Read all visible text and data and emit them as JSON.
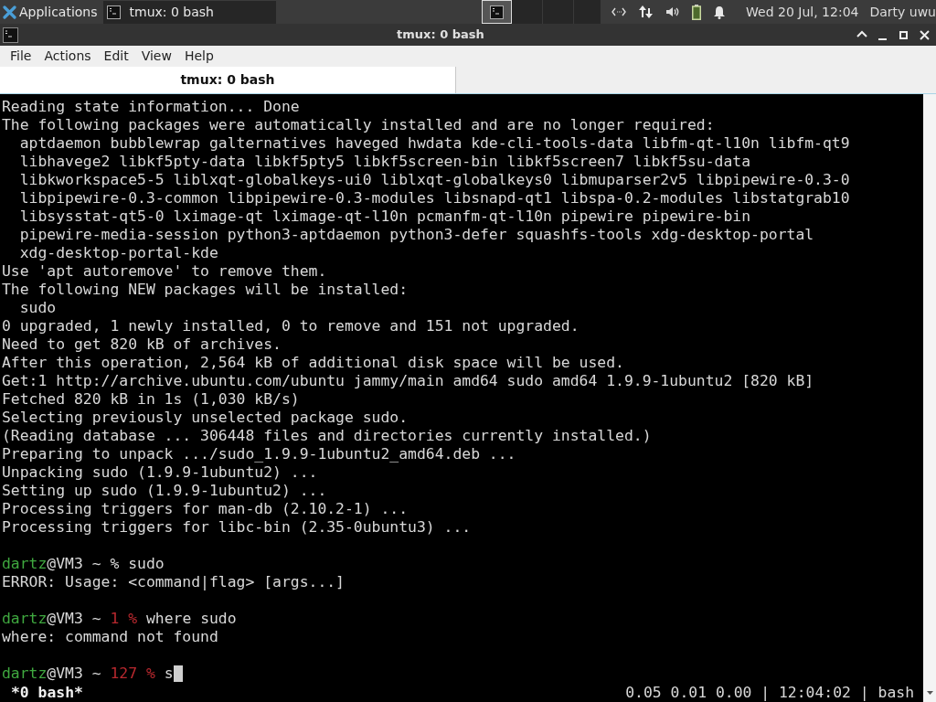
{
  "panel": {
    "apps_label": "Applications",
    "tasks": [
      {
        "label": "tmux: 0 bash",
        "selected": true
      }
    ],
    "clock": "Wed 20 Jul, 12:04",
    "user": "Darty uwu"
  },
  "window": {
    "title": "tmux: 0 bash"
  },
  "menu": [
    "File",
    "Actions",
    "Edit",
    "View",
    "Help"
  ],
  "tabs": [
    {
      "label": "tmux: 0 bash",
      "selected": true
    }
  ],
  "terminal": {
    "lines": [
      {
        "kind": "output",
        "text": "Reading state information... Done"
      },
      {
        "kind": "output",
        "text": "The following packages were automatically installed and are no longer required:"
      },
      {
        "kind": "output",
        "text": "  aptdaemon bubblewrap galternatives haveged hwdata kde-cli-tools-data libfm-qt-l10n libfm-qt9"
      },
      {
        "kind": "output",
        "text": "  libhavege2 libkf5pty-data libkf5pty5 libkf5screen-bin libkf5screen7 libkf5su-data"
      },
      {
        "kind": "output",
        "text": "  libkworkspace5-5 liblxqt-globalkeys-ui0 liblxqt-globalkeys0 libmuparser2v5 libpipewire-0.3-0"
      },
      {
        "kind": "output",
        "text": "  libpipewire-0.3-common libpipewire-0.3-modules libsnapd-qt1 libspa-0.2-modules libstatgrab10"
      },
      {
        "kind": "output",
        "text": "  libsysstat-qt5-0 lximage-qt lximage-qt-l10n pcmanfm-qt-l10n pipewire pipewire-bin"
      },
      {
        "kind": "output",
        "text": "  pipewire-media-session python3-aptdaemon python3-defer squashfs-tools xdg-desktop-portal"
      },
      {
        "kind": "output",
        "text": "  xdg-desktop-portal-kde"
      },
      {
        "kind": "output",
        "text": "Use 'apt autoremove' to remove them."
      },
      {
        "kind": "output",
        "text": "The following NEW packages will be installed:"
      },
      {
        "kind": "output",
        "text": "  sudo"
      },
      {
        "kind": "output",
        "text": "0 upgraded, 1 newly installed, 0 to remove and 151 not upgraded."
      },
      {
        "kind": "output",
        "text": "Need to get 820 kB of archives."
      },
      {
        "kind": "output",
        "text": "After this operation, 2,564 kB of additional disk space will be used."
      },
      {
        "kind": "output",
        "text": "Get:1 http://archive.ubuntu.com/ubuntu jammy/main amd64 sudo amd64 1.9.9-1ubuntu2 [820 kB]"
      },
      {
        "kind": "output",
        "text": "Fetched 820 kB in 1s (1,030 kB/s)"
      },
      {
        "kind": "output",
        "text": "Selecting previously unselected package sudo."
      },
      {
        "kind": "output",
        "text": "(Reading database ... 306448 files and directories currently installed.)"
      },
      {
        "kind": "output",
        "text": "Preparing to unpack .../sudo_1.9.9-1ubuntu2_amd64.deb ..."
      },
      {
        "kind": "output",
        "text": "Unpacking sudo (1.9.9-1ubuntu2) ..."
      },
      {
        "kind": "output",
        "text": "Setting up sudo (1.9.9-1ubuntu2) ..."
      },
      {
        "kind": "output",
        "text": "Processing triggers for man-db (2.10.2-1) ..."
      },
      {
        "kind": "output",
        "text": "Processing triggers for libc-bin (2.35-0ubuntu3) ..."
      },
      {
        "kind": "blank"
      },
      {
        "kind": "prompt",
        "user": "dartz",
        "host": "@VM3 ~",
        "sign": "%",
        "command": "sudo"
      },
      {
        "kind": "output",
        "text": "ERROR: Usage: <command|flag> [args...]"
      },
      {
        "kind": "blank"
      },
      {
        "kind": "prompt",
        "user": "dartz",
        "host": "@VM3 ~",
        "exit_code": "1",
        "sign": "%",
        "command": "where sudo"
      },
      {
        "kind": "output",
        "text": "where: command not found"
      },
      {
        "kind": "blank"
      },
      {
        "kind": "prompt",
        "user": "dartz",
        "host": "@VM3 ~",
        "exit_code": "127",
        "sign": "%",
        "command": "s",
        "cursor": true
      }
    ]
  },
  "status_bar": {
    "window_label": "*0 bash*",
    "right": "0.05 0.01 0.00 | 12:04:02 | bash"
  }
}
